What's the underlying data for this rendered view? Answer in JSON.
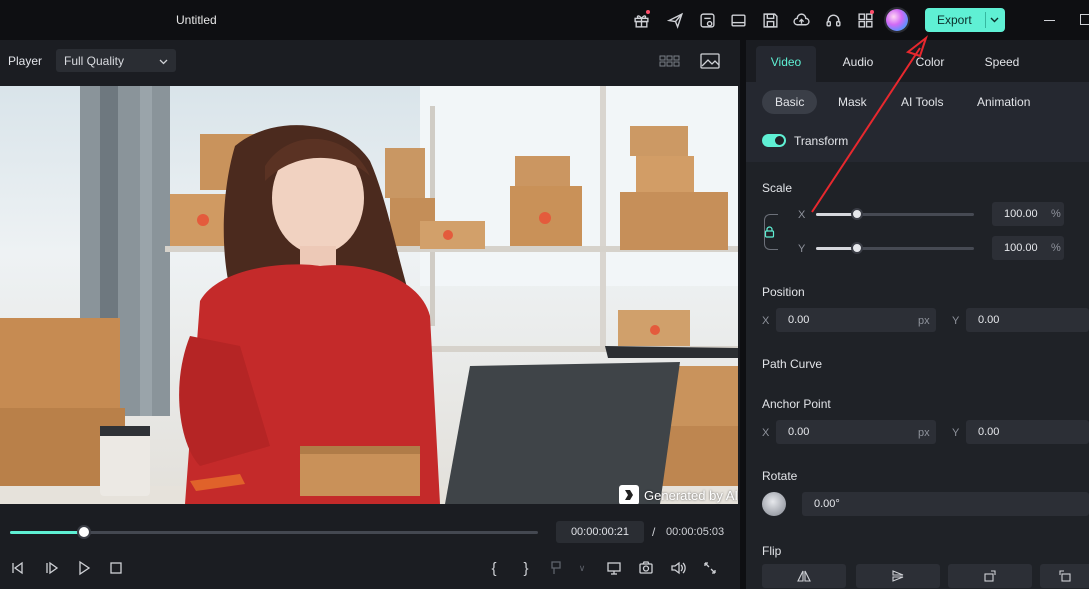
{
  "app": {
    "title": "Untitled",
    "accent": "#5ff0d4",
    "export_label": "Export",
    "toolbar_icons": [
      "gift-icon",
      "send-icon",
      "media-check-icon",
      "layout-icon",
      "save-icon",
      "cloud-upload-icon",
      "headset-icon",
      "apps-grid-icon",
      "ai-orb-icon"
    ]
  },
  "player": {
    "label": "Player",
    "quality": "Full Quality",
    "watermark": "Generated by AI",
    "current_time": "00:00:00:21",
    "separator": "/",
    "total_time": "00:00:05:03",
    "progress": 0.14,
    "controls": [
      "prev-frame-icon",
      "play-from-start-icon",
      "play-icon",
      "stop-icon",
      "mark-in-icon",
      "mark-out-icon",
      "clip-icon",
      "display-icon",
      "snapshot-icon",
      "volume-icon",
      "fullscreen-icon"
    ]
  },
  "panel": {
    "tabs": [
      "Video",
      "Audio",
      "Color",
      "Speed"
    ],
    "active_tab": "Video",
    "subtabs": [
      "Basic",
      "Mask",
      "AI Tools",
      "Animation"
    ],
    "active_subtab": "Basic",
    "transform_label": "Transform",
    "transform_on": true,
    "scale": {
      "label": "Scale",
      "x_label": "X",
      "y_label": "Y",
      "x_value": "100.00",
      "y_value": "100.00",
      "unit": "%",
      "x_slider": 0.26,
      "y_slider": 0.26
    },
    "position": {
      "label": "Position",
      "x_label": "X",
      "x_value": "0.00",
      "unit": "px",
      "y_label": "Y",
      "y_value": "0.00"
    },
    "path_curve_label": "Path Curve",
    "anchor": {
      "label": "Anchor Point",
      "x_label": "X",
      "x_value": "0.00",
      "unit": "px",
      "y_label": "Y",
      "y_value": "0.00"
    },
    "rotate": {
      "label": "Rotate",
      "value": "0.00°"
    },
    "flip_label": "Flip"
  }
}
